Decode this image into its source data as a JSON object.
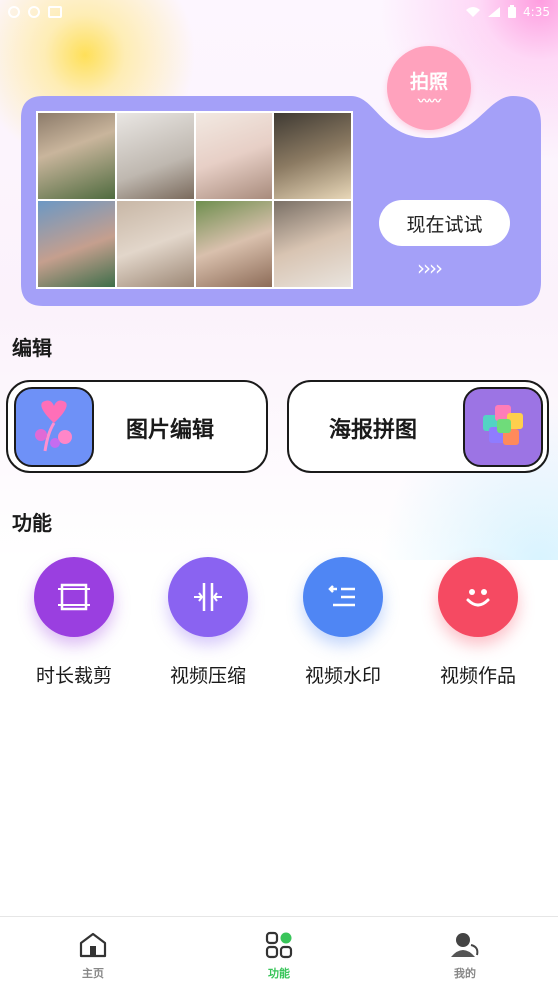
{
  "status_bar": {
    "time": "4:35"
  },
  "banner": {
    "badge_label": "拍照",
    "try_button": "现在试试",
    "arrows": "››››",
    "colors": {
      "panel": "#a4a0f8",
      "badge": "#ffa2bd"
    }
  },
  "edit_section": {
    "title": "编辑",
    "cards": [
      {
        "label": "图片编辑",
        "icon": "heart-balloon-icon",
        "icon_bg": "#6e91f7"
      },
      {
        "label": "海报拼图",
        "icon": "color-cubes-icon",
        "icon_bg": "#9c74e4"
      }
    ]
  },
  "function_section": {
    "title": "功能",
    "items": [
      {
        "label": "时长裁剪",
        "icon": "crop-icon",
        "color": "#9a3fe0"
      },
      {
        "label": "视频压缩",
        "icon": "compress-icon",
        "color": "#8a63f1"
      },
      {
        "label": "视频水印",
        "icon": "watermark-icon",
        "color": "#4f86f4"
      },
      {
        "label": "视频作品",
        "icon": "smile-icon",
        "color": "#f54a62"
      }
    ]
  },
  "bottom_nav": {
    "items": [
      {
        "label": "主页",
        "icon": "home-icon",
        "active": false
      },
      {
        "label": "功能",
        "icon": "grid-icon",
        "active": true
      },
      {
        "label": "我的",
        "icon": "user-icon",
        "active": false
      }
    ],
    "active_color": "#39c55a"
  }
}
